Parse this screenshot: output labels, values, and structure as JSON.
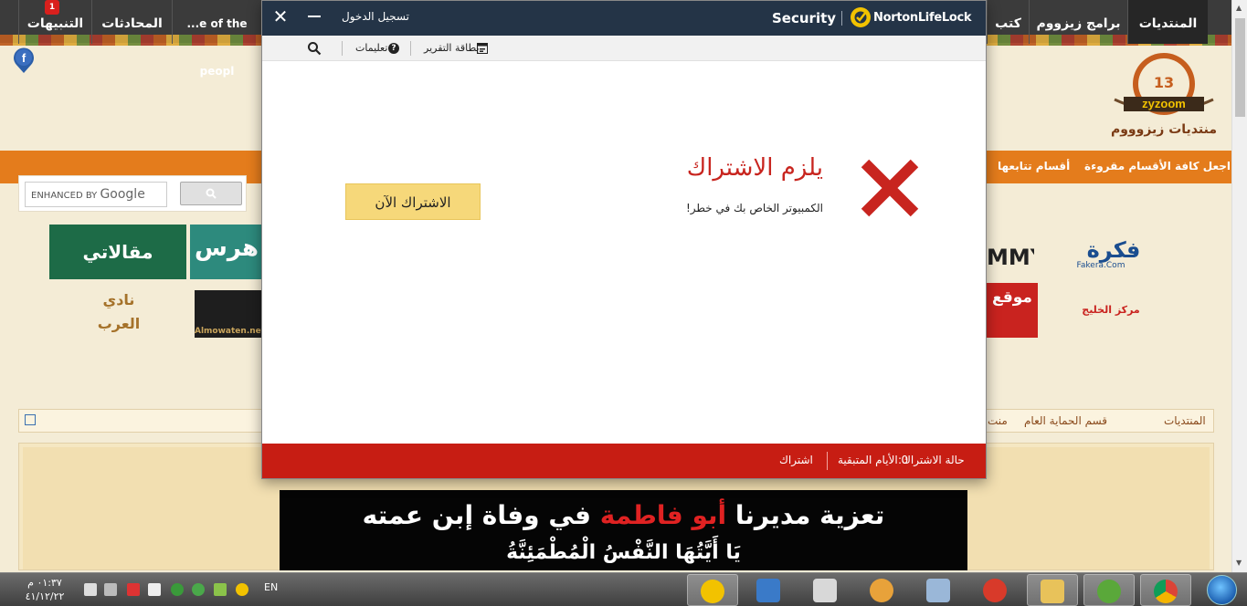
{
  "forum": {
    "nav": [
      {
        "label": "المنتديات"
      },
      {
        "label": "برامج زيزووم"
      },
      {
        "label": "كتب"
      },
      {
        "label": "...e of the peopl"
      },
      {
        "label": "المحادثات"
      },
      {
        "label": "التنبيهات"
      }
    ],
    "alerts_badge": "1",
    "orange_links": [
      "اجعل كافة الأقسام مقروءة",
      "أقسام تتابعها"
    ],
    "search": {
      "placeholder": "ENHANCED BY",
      "brand": "Google"
    },
    "ads": {
      "maqalati": "مقالاتي",
      "fhras": "هرس",
      "nadi": "نادي العرب",
      "mowaten": "Almowaten.net",
      "fakera": "فكرة",
      "fakera_sub": "Fakera.Com",
      "mmy": "MMY",
      "mawqe": "موقع",
      "khaleej": "مركز الخليج"
    },
    "breadcrumb": [
      "المنتديات",
      "قسم الحماية العام",
      "منت"
    ],
    "banner": {
      "line1_a": "تعزية مديرنا ",
      "line1_red": "أبو فاطمة",
      "line1_b": " في وفاة إبن عمته",
      "line2": "يَا أَيَّتُهَا النَّفْسُ الْمُطْمَئِنَّةُ"
    }
  },
  "norton": {
    "title_login": "تسجيل الدخول",
    "brand_security": "Security",
    "brand_name": "NortonLifeLock",
    "toolbar": {
      "report_card": "بطاقة التقرير",
      "help": "تعليمات"
    },
    "heading": "يلزم الاشتراك",
    "subtext": "الكمبيوتر الخاص بك في خطر!",
    "subscribe_button": "الاشتراك الآن",
    "status": {
      "label": "حالة الاشتراك:",
      "days_left": "0 الأيام المتبقية",
      "subscription_link": "اشتراك"
    },
    "colors": {
      "header": "#243447",
      "status_bar": "#c71d13",
      "button": "#f6d87a",
      "accent_red": "#c8251f"
    }
  },
  "taskbar": {
    "time": "٠١:٣٧ م",
    "date": "٤١/١٢/٢٢",
    "language": "EN",
    "apps": [
      "norton-app-icon",
      "mixer-icon",
      "scissors-icon",
      "paint-icon",
      "calculator-icon",
      "ccleaner-icon",
      "folder-icon",
      "utorrent-icon",
      "chrome-icon"
    ]
  }
}
